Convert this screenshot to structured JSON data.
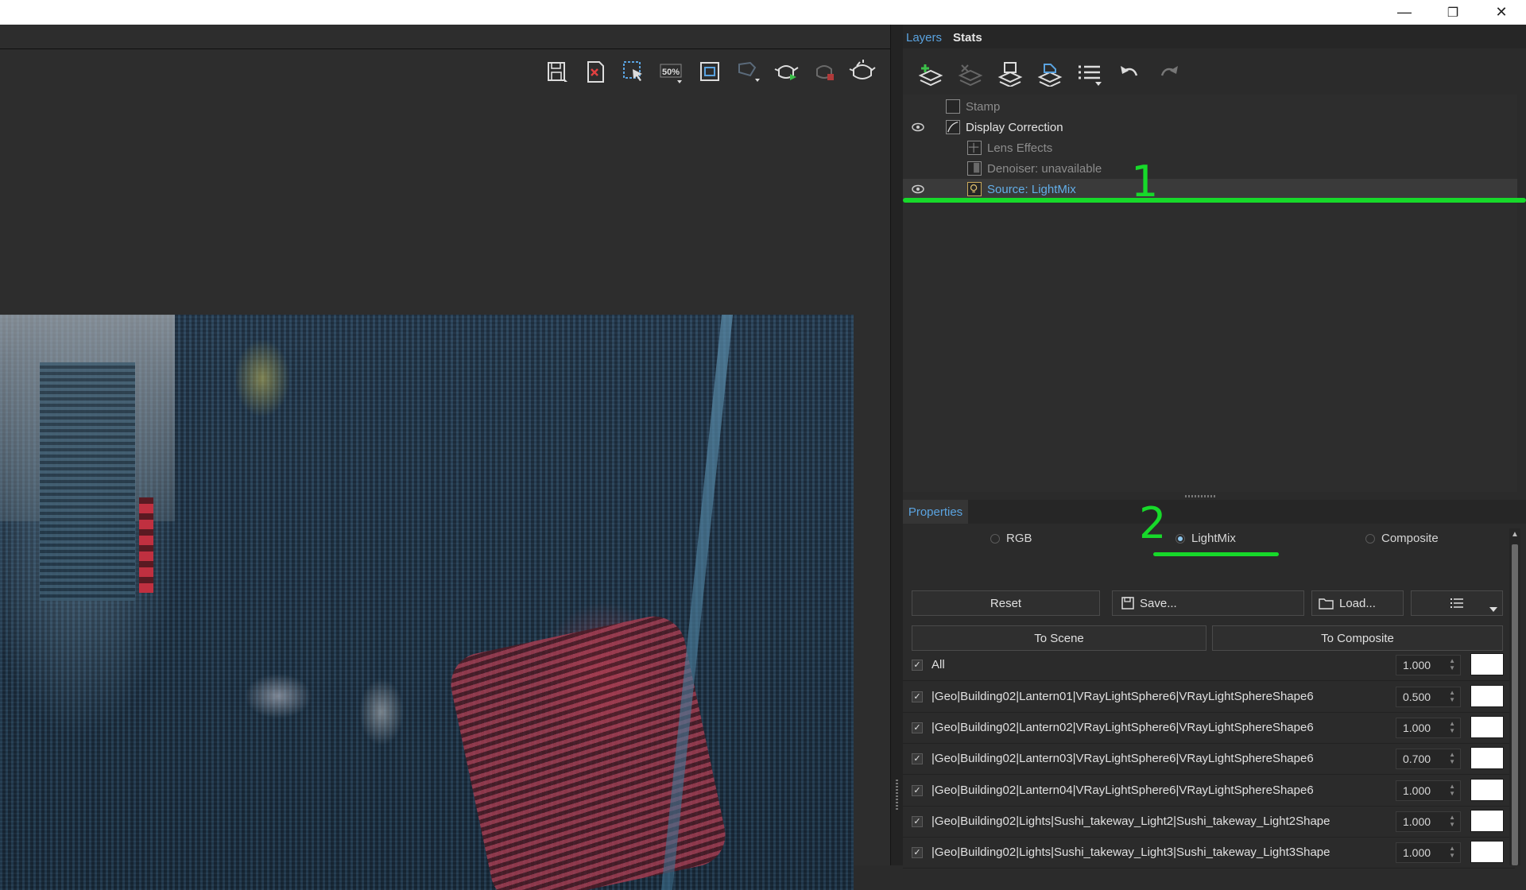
{
  "window": {
    "minimize_glyph": "—",
    "restore_glyph": "❐",
    "close_glyph": "✕"
  },
  "vfb_toolbar": {
    "icons": [
      "save-image-icon",
      "clear-image-icon",
      "region-render-icon",
      "zoom-50-icon",
      "fit-view-icon",
      "track-mouse-icon",
      "render-teapot-icon",
      "stop-render-icon",
      "render-last-icon"
    ],
    "zoom_label": "50%"
  },
  "panel": {
    "tabs": {
      "layers": "Layers",
      "stats": "Stats"
    },
    "layers_toolbar_icons": [
      "create-layer-icon",
      "delete-layer-icon",
      "save-layers-icon",
      "load-layers-icon",
      "layer-presets-icon",
      "undo-icon",
      "redo-icon"
    ],
    "layers": [
      {
        "label": "Stamp",
        "visible": false,
        "indent": 1,
        "icon": "stamp-icon",
        "state": "dim"
      },
      {
        "label": "Display Correction",
        "visible": true,
        "indent": 1,
        "icon": "curve-icon",
        "state": "bright"
      },
      {
        "label": "Lens Effects",
        "visible": false,
        "indent": 2,
        "icon": "lens-effects-icon",
        "state": "dim"
      },
      {
        "label": "Denoiser: unavailable",
        "visible": false,
        "indent": 2,
        "icon": "denoiser-icon",
        "state": "dim"
      },
      {
        "label": "Source: LightMix",
        "visible": true,
        "indent": 2,
        "icon": "lightmix-icon",
        "state": "selected"
      }
    ],
    "annotation_1": "1",
    "annotation_2": "2",
    "properties": {
      "tab": "Properties",
      "modes": {
        "rgb": "RGB",
        "lightmix": "LightMix",
        "composite": "Composite"
      },
      "selected_mode": "LightMix",
      "buttons": {
        "reset": "Reset",
        "save": "Save...",
        "load": "Load...",
        "to_scene": "To Scene",
        "to_composite": "To Composite"
      },
      "lights": [
        {
          "name": "All",
          "value": "1.000",
          "checked": true,
          "color": "#ffffff"
        },
        {
          "name": "|Geo|Building02|Lantern01|VRayLightSphere6|VRayLightSphereShape6",
          "value": "0.500",
          "checked": true,
          "color": "#ffffff"
        },
        {
          "name": "|Geo|Building02|Lantern02|VRayLightSphere6|VRayLightSphereShape6",
          "value": "1.000",
          "checked": true,
          "color": "#ffffff"
        },
        {
          "name": "|Geo|Building02|Lantern03|VRayLightSphere6|VRayLightSphereShape6",
          "value": "0.700",
          "checked": true,
          "color": "#ffffff"
        },
        {
          "name": "|Geo|Building02|Lantern04|VRayLightSphere6|VRayLightSphereShape6",
          "value": "1.000",
          "checked": true,
          "color": "#ffffff"
        },
        {
          "name": "|Geo|Building02|Lights|Sushi_takeway_Light2|Sushi_takeway_Light2Shape",
          "value": "1.000",
          "checked": true,
          "color": "#ffffff"
        },
        {
          "name": "|Geo|Building02|Lights|Sushi_takeway_Light3|Sushi_takeway_Light3Shape",
          "value": "1.000",
          "checked": true,
          "color": "#ffffff"
        }
      ]
    }
  },
  "colors": {
    "accent_blue": "#5aa3e0",
    "annotation_green": "#17d92a",
    "panel_bg": "#2b2b2b"
  }
}
